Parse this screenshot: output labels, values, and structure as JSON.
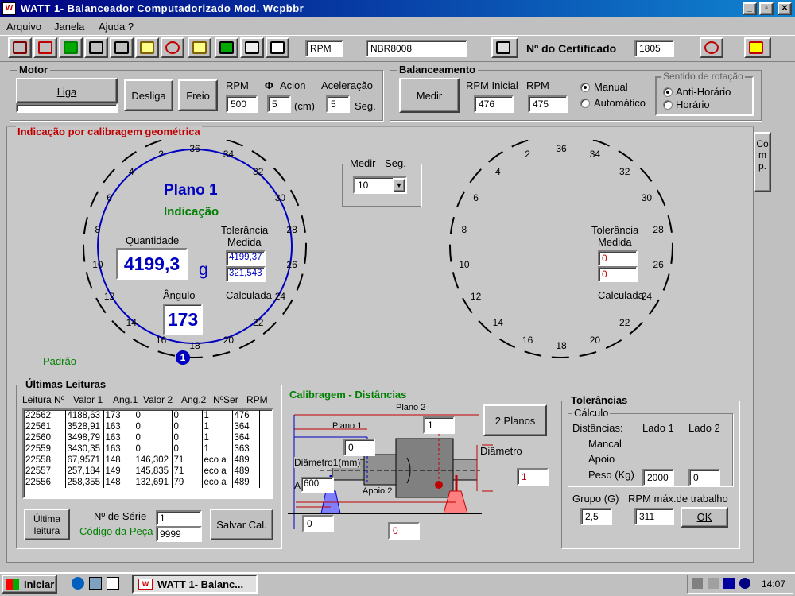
{
  "window": {
    "title": "WATT 1- Balanceador Computadorizado  Mod. Wcpbbr",
    "icon": "W"
  },
  "menu": [
    "Arquivo",
    "Janela",
    "Ajuda ?"
  ],
  "toolbar": {
    "rpm_field": "RPM",
    "norm_field": "NBR8008",
    "cert_label": "Nº do Certificado",
    "cert_value": "1805"
  },
  "motor": {
    "title": "Motor",
    "liga": "Liga",
    "desliga": "Desliga",
    "freio": "Freio",
    "rpm_label": "RPM",
    "rpm_value": "500",
    "acion_label": "Acion",
    "acion_symbol": "Φ",
    "acion_value": "5",
    "acion_unit": "(cm)",
    "acel_label": "Aceleração",
    "acel_value": "5",
    "acel_unit": "Seg."
  },
  "balanceamento": {
    "title": "Balanceamento",
    "medir": "Medir",
    "rpm_inicial_label": "RPM Inicial",
    "rpm_inicial_value": "476",
    "rpm_label": "RPM",
    "rpm_value": "475",
    "manual": "Manual",
    "automatico": "Automático",
    "sentido_title": "Sentido de rotação",
    "anti": "Anti-Horário",
    "horario": "Horário"
  },
  "main": {
    "title": "Indicação por calibragem geométrica",
    "comp": "Comp.",
    "medir_seg_label": "Medir - Seg.",
    "medir_seg_value": "10",
    "padrao": "Padrão"
  },
  "plane1": {
    "title": "Plano 1",
    "subtitle": "Indicação",
    "quantidade_label": "Quantidade",
    "quantidade_value": "4199,3",
    "unit": "g",
    "tol_label": "Tolerância",
    "medida_label": "Medida",
    "medida_value": "4199,37",
    "calc_value": "321,543",
    "calculada_label": "Calculada",
    "angulo_label": "Ângulo",
    "angulo_value": "173",
    "marker": "1"
  },
  "plane2": {
    "tol_label": "Tolerância",
    "medida_label": "Medida",
    "medida_value": "0",
    "calc_value": "0",
    "calculada_label": "Calculada"
  },
  "dial_ticks": [
    "36",
    "34",
    "32",
    "30",
    "28",
    "26",
    "24",
    "22",
    "20",
    "18",
    "16",
    "14",
    "12",
    "10",
    "8",
    "6",
    "4",
    "2"
  ],
  "leituras": {
    "title": "Últimas Leituras",
    "columns": [
      "Leitura Nº",
      "Valor 1",
      "Ang.1",
      "Valor 2",
      "Ang.2",
      "NºSer",
      "RPM"
    ],
    "rows": [
      [
        "22562",
        "4188,63",
        "173",
        "0",
        "0",
        "1",
        "476"
      ],
      [
        "22561",
        "3528,91",
        "163",
        "0",
        "0",
        "1",
        "364"
      ],
      [
        "22560",
        "3498,79",
        "163",
        "0",
        "0",
        "1",
        "364"
      ],
      [
        "22559",
        "3430,35",
        "163",
        "0",
        "0",
        "1",
        "363"
      ],
      [
        "22558",
        "67,9571",
        "148",
        "146,302",
        "71",
        "eco a",
        "489"
      ],
      [
        "22557",
        "257,184",
        "149",
        "145,835",
        "71",
        "eco a",
        "489"
      ],
      [
        "22556",
        "258,355",
        "148",
        "132,691",
        "79",
        "eco a",
        "489"
      ]
    ],
    "ultima_btn": "Última leitura",
    "serie_label": "Nº de Série",
    "serie_value": "1",
    "codigo_label": "Código da Peça",
    "codigo_value": "9999",
    "salvar_btn": "Salvar Cal."
  },
  "calib": {
    "title": "Calibragem - Distâncias",
    "plano2": "Plano 2",
    "plano2_value": "1",
    "plano1": "Plano 1",
    "plano1_value": "0",
    "diametro1": "Diâmetro1(mm)",
    "diametro1_value": "600",
    "a_label": "A",
    "apoio2": "Apoio 2",
    "diametro": "Diâmetro",
    "diametro_value": "1",
    "dist_a_value": "0",
    "dist_b_value": "0",
    "planos_btn": "2 Planos",
    "marker2": "2"
  },
  "tolerancias": {
    "title": "Tolerâncias",
    "calculo": "Cálculo",
    "distancias": "Distâncias:",
    "lado1": "Lado 1",
    "lado2": "Lado 2",
    "mancal": "Mancal",
    "apoio": "Apoio",
    "peso": "Peso (Kg)",
    "peso1": "2000",
    "peso2": "0",
    "grupo_label": "Grupo (G)",
    "grupo_value": "2,5",
    "rpm_max_label": "RPM máx.de trabalho",
    "rpm_max_value": "311",
    "ok": "OK"
  },
  "taskbar": {
    "start": "Iniciar",
    "task": "WATT 1- Balanc...",
    "clock": "14:07"
  }
}
